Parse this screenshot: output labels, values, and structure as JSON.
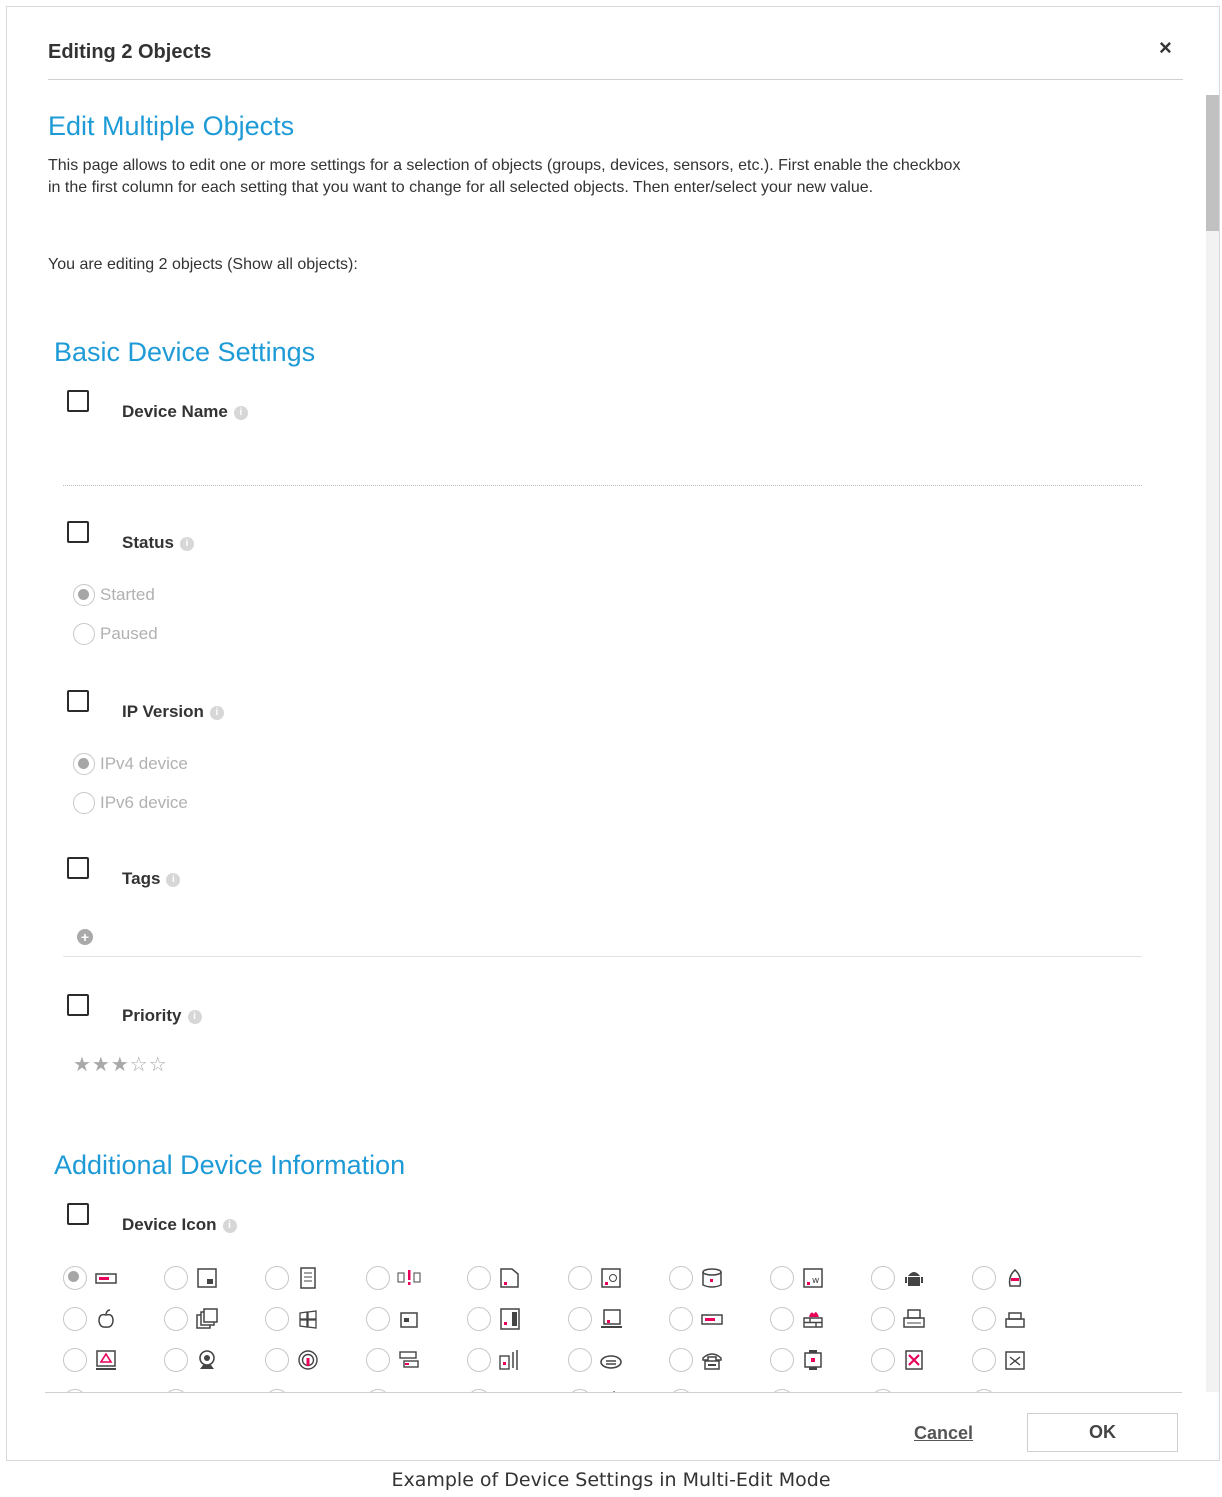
{
  "dialog": {
    "title": "Editing 2 Objects",
    "close_symbol": "×"
  },
  "intro": {
    "heading": "Edit Multiple Objects",
    "text_line1": "This page allows to edit one or more settings for a selection of objects (groups, devices, sensors, etc.). First enable the checkbox",
    "text_line2": "in the first column for each setting that you want to change for all selected objects. Then enter/select your new value.",
    "editing_prefix": "You are editing 2 objects (",
    "show_all_link": "Show all objects",
    "editing_suffix": "):"
  },
  "basic": {
    "title": "Basic Device Settings",
    "device_name": {
      "label": "Device Name",
      "value": ""
    },
    "status": {
      "label": "Status",
      "options": [
        "Started",
        "Paused"
      ],
      "selected": "Started"
    },
    "ip_version": {
      "label": "IP Version",
      "options": [
        "IPv4 device",
        "IPv6 device"
      ],
      "selected": "IPv4 device"
    },
    "tags": {
      "label": "Tags",
      "add_symbol": "+"
    },
    "priority": {
      "label": "Priority",
      "stars_filled": 3,
      "stars_total": 5,
      "stars_text": "★★★☆☆"
    }
  },
  "additional": {
    "title": "Additional Device Information",
    "device_icon": {
      "label": "Device Icon",
      "selected_index": 0,
      "icons": [
        "server-rack-icon",
        "device-dots-icon",
        "tower-server-icon",
        "alert-device-icon",
        "folder-device-icon",
        "email-device-icon",
        "database-device-icon",
        "web-device-icon",
        "android-icon",
        "linux-icon",
        "apple-icon",
        "virtual-machines-icon",
        "windows-icon",
        "storage-icon",
        "document-device-icon",
        "laptop-icon",
        "switch-device-icon",
        "firewall-icon",
        "printer-icon",
        "small-printer-icon",
        "warning-monitor-icon",
        "webcam-icon",
        "wireless-access-point-icon",
        "network-switch-icon",
        "signal-device-icon",
        "router-icon",
        "phone-icon",
        "modular-device-icon",
        "error-device-icon",
        "broken-device-icon",
        "blank-device-icon",
        "grid-device-icon",
        "vendor-logo-icon",
        "vendor-logo-icon",
        "vendor-logo-icon",
        "apple-icon",
        "vendor-logo-icon",
        "vendor-logo-icon",
        "vendor-logo-icon",
        "vendor-logo-icon"
      ],
      "colors": {
        "accent": "#e8005a",
        "icon": "#444444"
      }
    }
  },
  "footer": {
    "cancel_label": "Cancel",
    "ok_label": "OK"
  },
  "caption": "Example of Device Settings in Multi-Edit Mode",
  "theme": {
    "heading_color": "#1e9bd7"
  }
}
